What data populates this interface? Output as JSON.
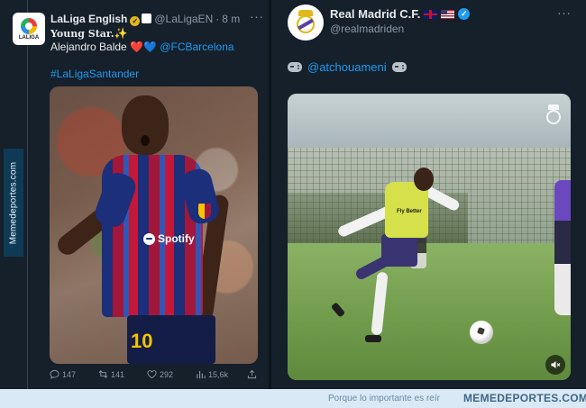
{
  "watermark": {
    "vertical_text": "Memedeportes.com"
  },
  "left_tweet": {
    "author_name": "LaLiga English",
    "handle": "@LaLigaEN",
    "time": "8 m",
    "separator": "·",
    "avatar_logo_text": "LALIGA",
    "line1": "Young Star.",
    "line1_emoji": "✨",
    "line2_name": "Alejandro Balde",
    "line2_emojis_red": "❤️",
    "line2_emojis_blue": "💙",
    "line2_mention": "@FCBarcelona",
    "hashtag": "#LaLigaSantander",
    "media": {
      "sponsor": "Spotify",
      "shorts_number": "10"
    },
    "actions": {
      "replies": "147",
      "retweets": "141",
      "likes": "292",
      "views": "15,6k"
    },
    "more_icon": "···"
  },
  "right_tweet": {
    "author_name": "Real Madrid C.F.",
    "handle": "@realmadriden",
    "text_mention": "@atchouameni",
    "bib_text": "Fly Better",
    "more_icon": "···",
    "flags": [
      "uk-flag",
      "us-flag"
    ]
  },
  "footer": {
    "tagline": "Porque lo importante es reír",
    "brand": "MEMEDEPORTES.COM"
  },
  "colors": {
    "background": "#15202b",
    "text_primary": "#e7e9ea",
    "text_secondary": "#8b98a5",
    "link": "#1d9bf0",
    "verified_gold": "#e2b719",
    "verified_blue": "#1d9bf0",
    "strip_bg": "#d9e9f5"
  }
}
